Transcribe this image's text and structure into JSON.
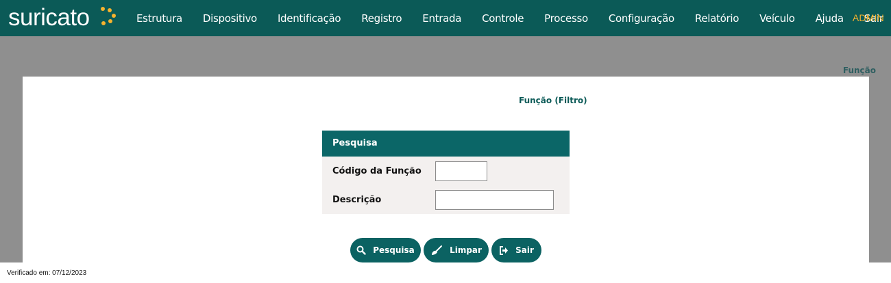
{
  "app": {
    "logo_text": "suricato"
  },
  "nav": {
    "items": [
      {
        "label": "Estrutura"
      },
      {
        "label": "Dispositivo"
      },
      {
        "label": "Identificação"
      },
      {
        "label": "Registro"
      },
      {
        "label": "Entrada"
      },
      {
        "label": "Controle"
      },
      {
        "label": "Processo"
      },
      {
        "label": "Configuração"
      },
      {
        "label": "Relatório"
      },
      {
        "label": "Veículo"
      },
      {
        "label": "Ajuda"
      },
      {
        "label": "Sair"
      }
    ],
    "user": "ADMIN"
  },
  "breadcrumb": "Função",
  "page": {
    "title": "Função (Filtro)",
    "search": {
      "header": "Pesquisa",
      "fields": [
        {
          "label": "Código da Função",
          "value": "",
          "placeholder": ""
        },
        {
          "label": "Descrição",
          "value": "",
          "placeholder": ""
        }
      ]
    },
    "buttons": {
      "search": "Pesquisa",
      "clear": "Limpar",
      "exit": "Sair"
    }
  },
  "footer": {
    "verified": "Verificado em: 07/12/2023"
  },
  "colors": {
    "navbar": "#0b5a57",
    "accent_admin": "#f5b22e",
    "logo_dots": "#f5b22e",
    "search_header": "#0b6667",
    "button": "#0b6262",
    "backdrop": "#8f8f8f"
  },
  "icons": {
    "search": "magnifier-icon",
    "clear": "broom-icon",
    "exit": "sign-out-icon"
  }
}
